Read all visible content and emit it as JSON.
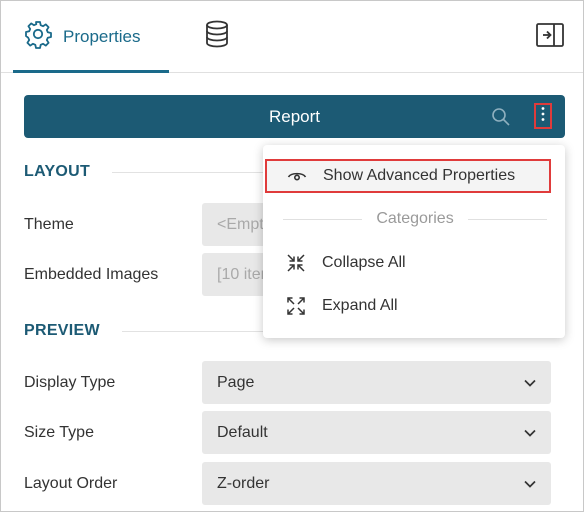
{
  "tabs": {
    "properties_label": "Properties",
    "active": "properties",
    "icons": {
      "properties": "gear-icon",
      "data": "database-icon",
      "collapse": "collapse-panel-icon"
    }
  },
  "report_bar": {
    "title": "Report",
    "search_icon": "search-icon",
    "menu_icon": "kebab-menu-icon"
  },
  "sections": {
    "layout": {
      "title": "LAYOUT",
      "rows": [
        {
          "label": "Theme",
          "value": "<Empty>",
          "muted": true
        },
        {
          "label": "Embedded Images",
          "value": "[10 items]",
          "muted": true
        }
      ]
    },
    "preview": {
      "title": "PREVIEW",
      "rows": [
        {
          "label": "Display Type",
          "value": "Page"
        },
        {
          "label": "Size Type",
          "value": "Default"
        },
        {
          "label": "Layout Order",
          "value": "Z-order"
        }
      ]
    }
  },
  "menu": {
    "advanced": {
      "label": "Show Advanced Properties",
      "icon": "eye-icon"
    },
    "categories_label": "Categories",
    "collapse_all": {
      "label": "Collapse All",
      "icon": "collapse-arrows-icon"
    },
    "expand_all": {
      "label": "Expand All",
      "icon": "expand-arrows-icon"
    }
  },
  "colors": {
    "accent": "#1a6a8a",
    "report_bar": "#1c5a74",
    "highlight_border": "#e03b3b",
    "field_bg": "#e8e8e8"
  }
}
